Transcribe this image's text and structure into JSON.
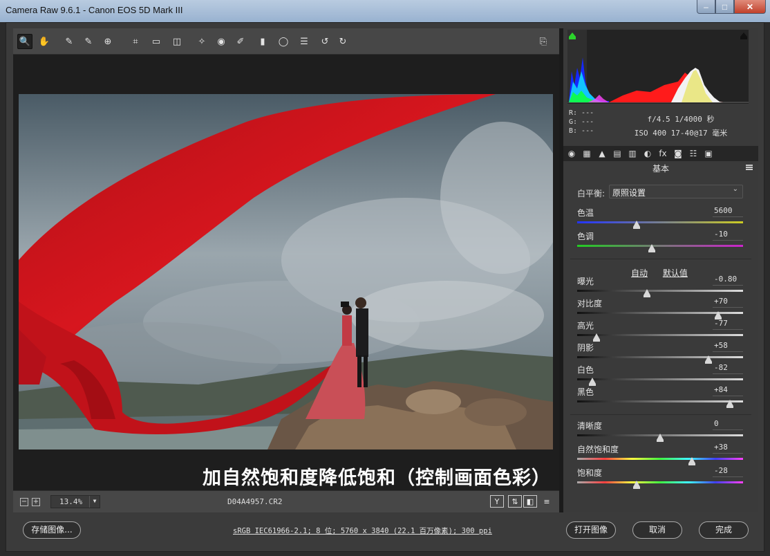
{
  "window": {
    "title": "Camera Raw 9.6.1 -  Canon EOS 5D Mark III",
    "controls": [
      "–",
      "□",
      "✕"
    ]
  },
  "toolbar": {
    "tools": [
      {
        "name": "zoom-tool-icon",
        "glyph": "🔍",
        "active": true
      },
      {
        "name": "hand-tool-icon",
        "glyph": "✋"
      },
      {
        "name": "white-balance-tool-icon",
        "glyph": "✎"
      },
      {
        "name": "color-sampler-tool-icon",
        "glyph": "✎"
      },
      {
        "name": "targeted-adjustment-tool-icon",
        "glyph": "⊕"
      },
      {
        "name": "crop-tool-icon",
        "glyph": "⌗"
      },
      {
        "name": "straighten-tool-icon",
        "glyph": "▭"
      },
      {
        "name": "transform-tool-icon",
        "glyph": "◫"
      },
      {
        "name": "spot-removal-tool-icon",
        "glyph": "✧"
      },
      {
        "name": "red-eye-removal-tool-icon",
        "glyph": "◉"
      },
      {
        "name": "adjustment-brush-icon",
        "glyph": "✐"
      },
      {
        "name": "graduated-filter-icon",
        "glyph": "▮"
      },
      {
        "name": "radial-filter-icon",
        "glyph": "◯"
      },
      {
        "name": "preferences-icon",
        "glyph": "☰"
      },
      {
        "name": "rotate-left-icon",
        "glyph": "↺"
      },
      {
        "name": "rotate-right-icon",
        "glyph": "↻"
      }
    ],
    "fullscreen_icon": "⎘"
  },
  "preview": {
    "caption": "加自然饱和度降低饱和（控制画面色彩）"
  },
  "statusbar": {
    "zoom_minus": "−",
    "zoom_plus": "+",
    "zoom": "13.4%",
    "filename": "D04A4957.CR2",
    "icons": [
      "Y",
      "⇅",
      "◧",
      "≡"
    ]
  },
  "readout": {
    "r": "R:  ---",
    "g": "G:  ---",
    "b": "B:  ---",
    "exposure_line": "f/4.5  1/4000 秒",
    "iso_line": "ISO 400  17-40@17 毫米"
  },
  "panel": {
    "tab_icons": [
      "◉",
      "▦",
      "▲",
      "▤",
      "▥",
      "◐",
      "fx",
      "◙",
      "☷",
      "▣"
    ],
    "title": "基本",
    "wb_label": "白平衡:",
    "wb_value": "原照设置",
    "auto": "自动",
    "default": "默认值",
    "sliders": [
      {
        "label": "色温",
        "value": "5600",
        "pos": 0.36,
        "track": "temp"
      },
      {
        "label": "色调",
        "value": "-10",
        "pos": 0.45,
        "track": "tint"
      },
      {
        "label": "曝光",
        "value": "-0.80",
        "pos": 0.42,
        "track": "gray"
      },
      {
        "label": "对比度",
        "value": "+70",
        "pos": 0.85,
        "track": "gray"
      },
      {
        "label": "高光",
        "value": "-77",
        "pos": 0.115,
        "track": "gray"
      },
      {
        "label": "阴影",
        "value": "+58",
        "pos": 0.79,
        "track": "gray"
      },
      {
        "label": "白色",
        "value": "-82",
        "pos": 0.09,
        "track": "gray"
      },
      {
        "label": "黑色",
        "value": "+84",
        "pos": 0.92,
        "track": "gray"
      },
      {
        "label": "清晰度",
        "value": "0",
        "pos": 0.5,
        "track": "gray"
      },
      {
        "label": "自然饱和度",
        "value": "+38",
        "pos": 0.69,
        "track": "sat"
      },
      {
        "label": "饱和度",
        "value": "-28",
        "pos": 0.36,
        "track": "sat"
      }
    ]
  },
  "bottom": {
    "save": "存储图像...",
    "workflow": "sRGB IEC61966-2.1; 8 位; 5760 x 3840 (22.1 百万像素); 300 ppi",
    "open": "打开图像",
    "cancel": "取消",
    "done": "完成"
  },
  "colors": {
    "panel_bg": "#3a3a3a",
    "toolbar_bg": "#474747",
    "fabric_red": "#d3141c"
  }
}
